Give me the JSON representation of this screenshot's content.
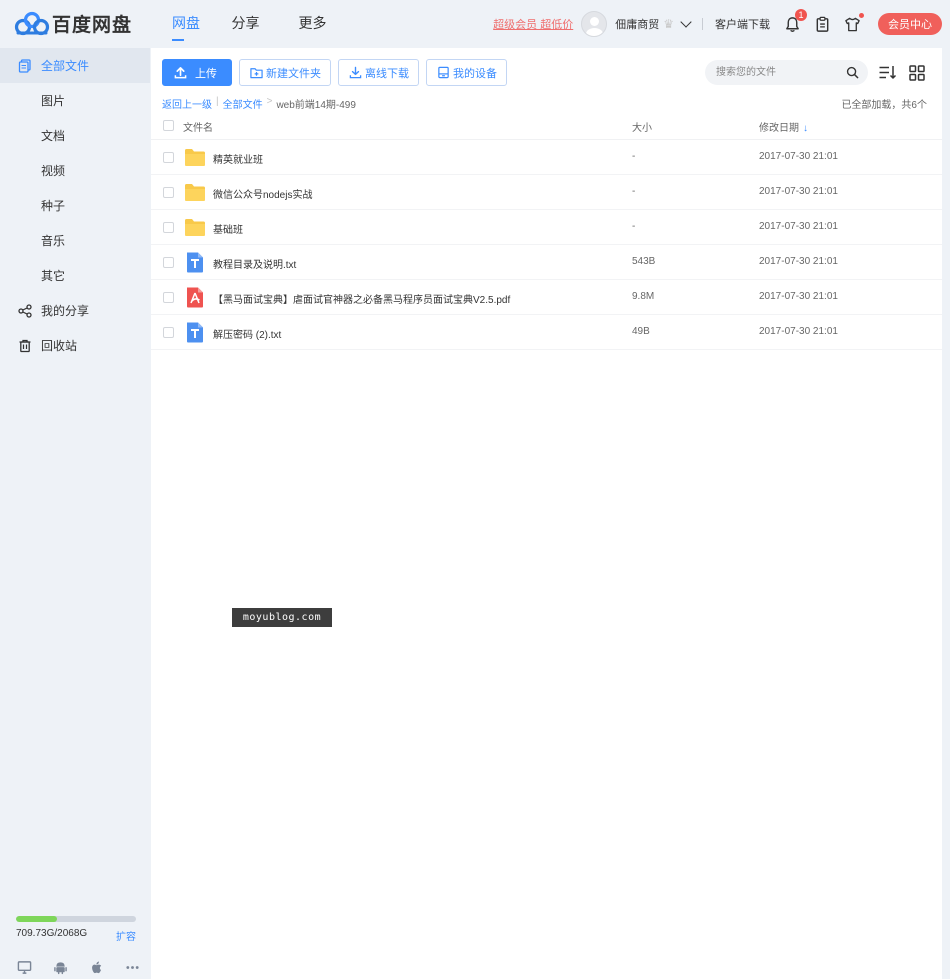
{
  "app": {
    "logo_text": "百度网盘",
    "brand_color": "#3b8cff"
  },
  "nav": {
    "items": [
      {
        "label": "网盘",
        "active": true
      },
      {
        "label": "分享"
      },
      {
        "label": "更多"
      }
    ]
  },
  "header": {
    "vip_link": "超级会员 超低价",
    "username": "佃庸商贸",
    "client_download": "客户端下载",
    "notification_count": "1",
    "member_button": "会员中心",
    "icons": [
      "bell-icon",
      "clipboard-icon",
      "shirt-icon"
    ]
  },
  "sidebar": {
    "items": [
      {
        "label": "全部文件",
        "icon": "files-icon",
        "active": true
      },
      {
        "label": "图片",
        "sub": true
      },
      {
        "label": "文档",
        "sub": true
      },
      {
        "label": "视频",
        "sub": true
      },
      {
        "label": "种子",
        "sub": true
      },
      {
        "label": "音乐",
        "sub": true
      },
      {
        "label": "其它",
        "sub": true
      },
      {
        "label": "我的分享",
        "icon": "share-icon"
      },
      {
        "label": "回收站",
        "icon": "trash-icon"
      }
    ],
    "quota": {
      "text": "709.73G/2068G",
      "used_fraction": 0.343,
      "expand_label": "扩容"
    },
    "client_icons": [
      "desktop-icon",
      "android-icon",
      "apple-icon",
      "more-icon"
    ]
  },
  "toolbar": {
    "upload_label": "上传",
    "new_folder_label": "新建文件夹",
    "offline_download_label": "离线下载",
    "my_devices_label": "我的设备"
  },
  "search": {
    "placeholder": "搜索您的文件"
  },
  "breadcrumb": {
    "back": "返回上一级",
    "divider": "|",
    "root": "全部文件",
    "arrow": ">",
    "current": "web前端14期-499"
  },
  "load_status": "已全部加载，共6个",
  "table": {
    "headers": {
      "name": "文件名",
      "size": "大小",
      "modified": "修改日期",
      "sort_indicator": "↓"
    },
    "rows": [
      {
        "type": "folder",
        "name": "精英就业班",
        "size": "-",
        "modified": "2017-07-30 21:01"
      },
      {
        "type": "folder",
        "name": "微信公众号nodejs实战",
        "size": "-",
        "modified": "2017-07-30 21:01"
      },
      {
        "type": "folder",
        "name": "基础班",
        "size": "-",
        "modified": "2017-07-30 21:01"
      },
      {
        "type": "txt",
        "name": "教程目录及说明.txt",
        "size": "543B",
        "modified": "2017-07-30 21:01"
      },
      {
        "type": "pdf",
        "name": "【黑马面试宝典】虐面试官神器之必备黑马程序员面试宝典V2.5.pdf",
        "size": "9.8M",
        "modified": "2017-07-30 21:01"
      },
      {
        "type": "txt",
        "name": "解压密码 (2).txt",
        "size": "49B",
        "modified": "2017-07-30 21:01"
      }
    ]
  },
  "watermark": "moyublog.com"
}
